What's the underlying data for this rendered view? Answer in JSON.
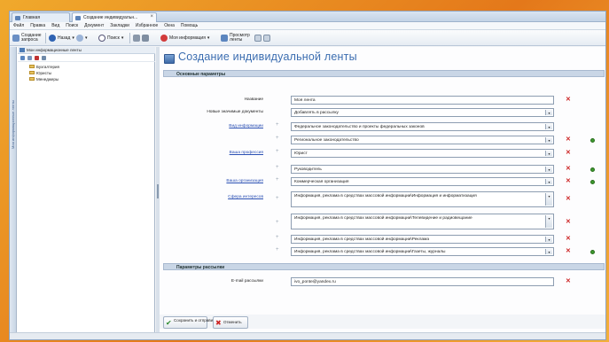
{
  "browser": {
    "tabs": [
      {
        "label": "Главная",
        "active": false
      },
      {
        "label": "Создание индивидуальн...",
        "active": true
      }
    ],
    "close_glyph": "×"
  },
  "menu": [
    "Файл",
    "Правка",
    "Вид",
    "Поиск",
    "Документ",
    "Закладки",
    "Избранное",
    "Окна",
    "Помощь"
  ],
  "toolbar": {
    "new_query": "Создание запроса",
    "back": "Назад",
    "forward": "",
    "search": "Поиск",
    "my_info": "Моя информация",
    "view_lenta": "Просмотр ленты"
  },
  "sidebar": {
    "strip_label": "Мои информационные ленты",
    "header": "Мои информационные ленты",
    "items": [
      "Бухгалтерия",
      "Юристы",
      "Менеджеры"
    ]
  },
  "page": {
    "title": "Создание индивидуальной ленты",
    "sections": {
      "basic": "Основные параметры",
      "mailing": "Параметры рассылки"
    },
    "fields": {
      "name_label": "Название",
      "name_value": "Моя лента",
      "new_docs_label": "Новые значимые документы",
      "new_docs_value": "Добавлять в рассылку",
      "info_type_label": "Вид информации",
      "info_type_1": "Федеральное законодательство и проекты федеральных законов",
      "info_type_2": "Региональное законодательство",
      "prof_label": "Ваша профессия",
      "prof_1": "Юрист",
      "prof_2": "Руководитель",
      "org_label": "Ваша организация",
      "org_1": "Коммерческая организация",
      "sphere_label": "Сфера интересов",
      "sphere_1": "Информация, реклама в средствах массовой информации\\Информация и информатизация",
      "sphere_2": "Информация, реклама в средствах массовой информации\\Телевидение и радиовещание",
      "sphere_3": "Информация, реклама в средствах массовой информации\\Реклама",
      "sphere_4": "Информация, реклама в средствах массовой информации\\Газеты, журналы",
      "email_label": "E-mail рассылки",
      "email_value": "ivo_ponte@yandex.ru"
    },
    "glyphs": {
      "plus": "+",
      "delete": "✕",
      "dropdown": "▾"
    }
  },
  "footer": {
    "save": "Сохранить и отправить",
    "cancel": "Отменить"
  },
  "colors": {
    "accent": "#3b6db0",
    "section_bg": "#c9d6e6",
    "delete": "#cc2222",
    "add": "#3d9a2d"
  }
}
